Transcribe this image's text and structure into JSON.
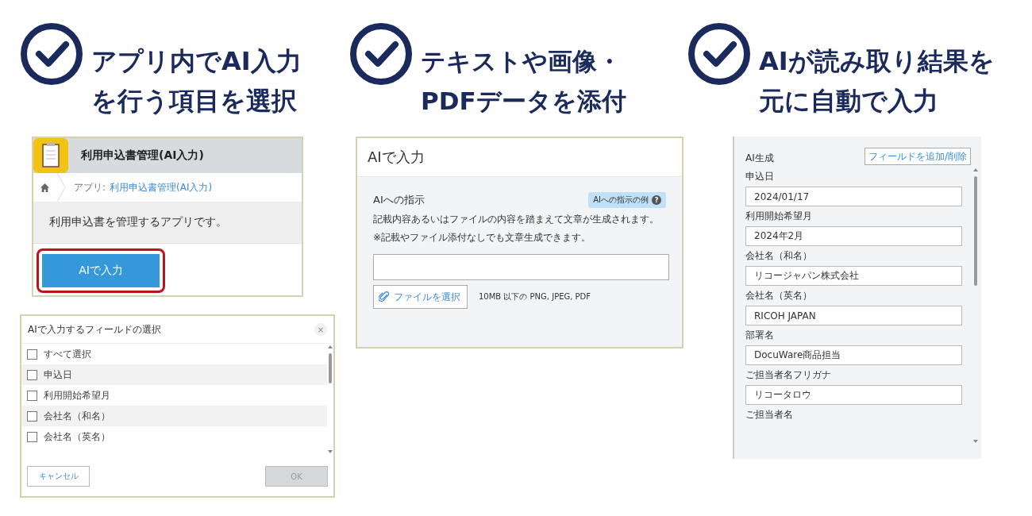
{
  "steps": [
    {
      "lines": [
        "アプリ内でAI入力",
        "を行う項目を選択"
      ]
    },
    {
      "lines": [
        "テキストや画像・",
        "PDFデータを添付"
      ]
    },
    {
      "lines": [
        "AIが読み取り結果を",
        "元に自動で入力"
      ]
    }
  ],
  "app_card": {
    "title": "利用申込書管理(AI入力)",
    "breadcrumb_prefix": "アプリ:",
    "breadcrumb_link": "利用申込書管理(AI入力)",
    "description": "利用申込書を管理するアプリです。",
    "ai_button": "AIで入力",
    "highlighted": true
  },
  "field_dialog": {
    "title": "AIで入力するフィールドの選択",
    "close": "×",
    "items": [
      {
        "label": "すべて選択",
        "checked": false
      },
      {
        "label": "申込日",
        "checked": false
      },
      {
        "label": "利用開始希望月",
        "checked": false
      },
      {
        "label": "会社名（和名）",
        "checked": false
      },
      {
        "label": "会社名（英名）",
        "checked": false
      }
    ],
    "cancel": "キャンセル",
    "ok": "OK",
    "ok_disabled": true
  },
  "ai_panel": {
    "title": "AIで入力",
    "instruction_label": "AIへの指示",
    "examples_button": "AIへの指示の例",
    "help": "?",
    "notes": [
      "記載内容あるいはファイルの内容を踏まえて文章が生成されます。",
      "※記載やファイル添付なしでも文章生成できます。"
    ],
    "file_button": "ファイルを選択",
    "file_hint": "10MB 以下の PNG, JPEG, PDF"
  },
  "result_panel": {
    "title": "AI生成",
    "edit_button": "フィールドを追加/削除",
    "fields": [
      {
        "label": "申込日",
        "value": "2024/01/17"
      },
      {
        "label": "利用開始希望月",
        "value": "2024年2月"
      },
      {
        "label": "会社名（和名）",
        "value": "リコージャパン株式会社"
      },
      {
        "label": "会社名（英名）",
        "value": "RICOH JAPAN"
      },
      {
        "label": "部署名",
        "value": "DocuWare商品担当"
      },
      {
        "label": "ご担当者名フリガナ",
        "value": "リコータロウ"
      },
      {
        "label": "ご担当者名"
      }
    ]
  }
}
